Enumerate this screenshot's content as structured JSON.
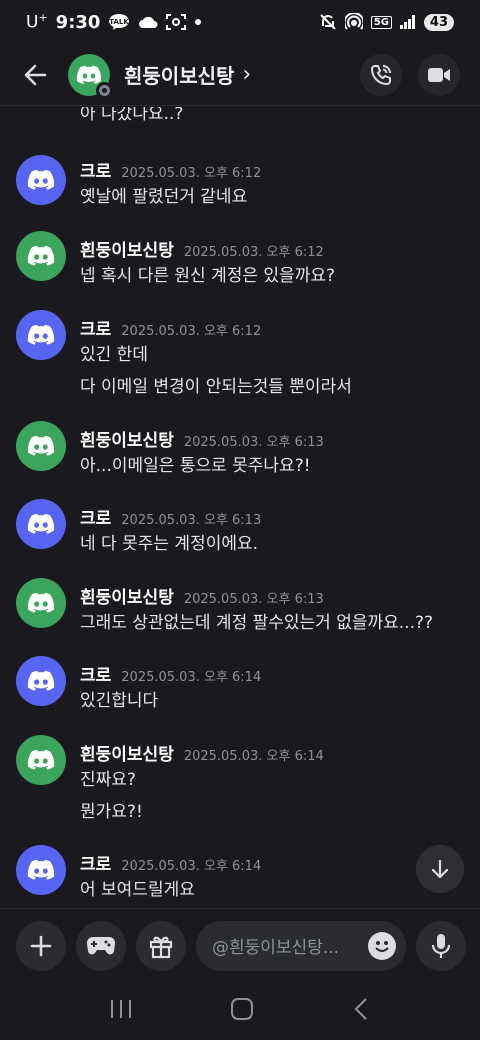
{
  "status_bar": {
    "carrier": "U",
    "carrier_sup": "+",
    "time": "9:30",
    "talk_label": "TALK",
    "network": "5G",
    "battery": "43"
  },
  "header": {
    "title": "흰둥이보신탕",
    "chevron": "›"
  },
  "truncated_text": "아 나갔나요..?",
  "messages": [
    {
      "author": "크로",
      "avatar": "blue",
      "timestamp": "2025.05.03. 오후 6:12",
      "lines": [
        "옛날에 팔렸던거 같네요"
      ]
    },
    {
      "author": "흰둥이보신탕",
      "avatar": "green",
      "timestamp": "2025.05.03. 오후 6:12",
      "lines": [
        "넵 혹시 다른 원신 계정은 있을까요?"
      ]
    },
    {
      "author": "크로",
      "avatar": "blue",
      "timestamp": "2025.05.03. 오후 6:12",
      "lines": [
        "있긴 한데",
        "다 이메일 변경이 안되는것들 뿐이라서"
      ]
    },
    {
      "author": "흰둥이보신탕",
      "avatar": "green",
      "timestamp": "2025.05.03. 오후 6:13",
      "lines": [
        "아...이메일은 통으로 못주나요?!"
      ]
    },
    {
      "author": "크로",
      "avatar": "blue",
      "timestamp": "2025.05.03. 오후 6:13",
      "lines": [
        "네 다 못주는 계정이에요."
      ]
    },
    {
      "author": "흰둥이보신탕",
      "avatar": "green",
      "timestamp": "2025.05.03. 오후 6:13",
      "lines": [
        "그래도 상관없는데 계정 팔수있는거 없을까요...??"
      ]
    },
    {
      "author": "크로",
      "avatar": "blue",
      "timestamp": "2025.05.03. 오후 6:14",
      "lines": [
        "있긴합니다"
      ]
    },
    {
      "author": "흰둥이보신탕",
      "avatar": "green",
      "timestamp": "2025.05.03. 오후 6:14",
      "lines": [
        "진짜요?",
        "뭔가요?!"
      ]
    },
    {
      "author": "크로",
      "avatar": "blue",
      "timestamp": "2025.05.03. 오후 6:14",
      "lines": [
        "어 보여드릴게요"
      ]
    }
  ],
  "composer": {
    "placeholder": "@흰둥이보신탕..."
  },
  "colors": {
    "background": "#1a1a1e",
    "blurple": "#5865f2",
    "green": "#3ba55d",
    "muted": "#8e9297"
  }
}
